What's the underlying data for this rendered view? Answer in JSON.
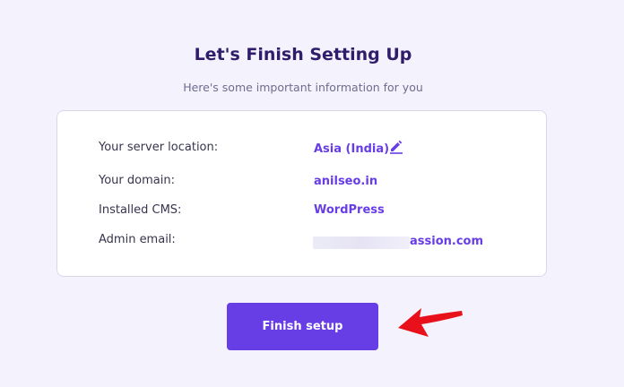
{
  "header": {
    "title": "Let's Finish Setting Up",
    "subtitle": "Here's some important information for you"
  },
  "info": {
    "server_location_label": "Your server location:",
    "server_location_value": "Asia (India)",
    "domain_label": "Your domain:",
    "domain_value": "anilseo.in",
    "cms_label": "Installed CMS:",
    "cms_value": "WordPress",
    "email_label": "Admin email:",
    "email_value_visible": "assion.com"
  },
  "actions": {
    "finish_label": "Finish setup"
  },
  "icons": {
    "edit": "pencil-edit-icon",
    "annotation": "red-arrow-icon"
  },
  "colors": {
    "accent": "#673de6",
    "heading": "#2f1c6a",
    "annotation": "#e8101a",
    "background": "#f3f2fd"
  }
}
